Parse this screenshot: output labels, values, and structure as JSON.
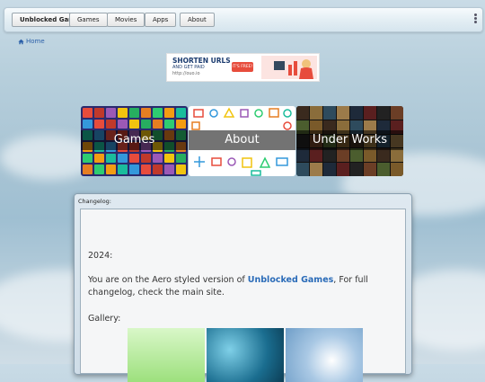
{
  "nav": {
    "items": [
      {
        "label": "Unblocked Games",
        "active": true
      },
      {
        "label": "Games",
        "active": false
      },
      {
        "label": "Movies",
        "active": false
      },
      {
        "label": "Apps",
        "active": false
      },
      {
        "label": "About",
        "active": false
      }
    ]
  },
  "breadcrumb": {
    "home_label": "Home"
  },
  "ad": {
    "headline": "SHORTEN URLS",
    "subline": "AND GET PAID",
    "url": "http://ouo.io",
    "button": "IT'S FREE!"
  },
  "tiles": [
    {
      "label": "Games"
    },
    {
      "label": "About"
    },
    {
      "label": "Under Works"
    }
  ],
  "changelog": {
    "title": "Changelog:",
    "year": "2024:",
    "text_before": "You are on the Aero styled version of ",
    "link_text": "Unblocked Games",
    "text_after": ", For full changelog, check the main site.",
    "gallery_label": "Gallery:"
  },
  "colors": {
    "link": "#2a6bb8",
    "accent_ad": "#e74c3c",
    "panel_border": "#8aa0b0"
  }
}
